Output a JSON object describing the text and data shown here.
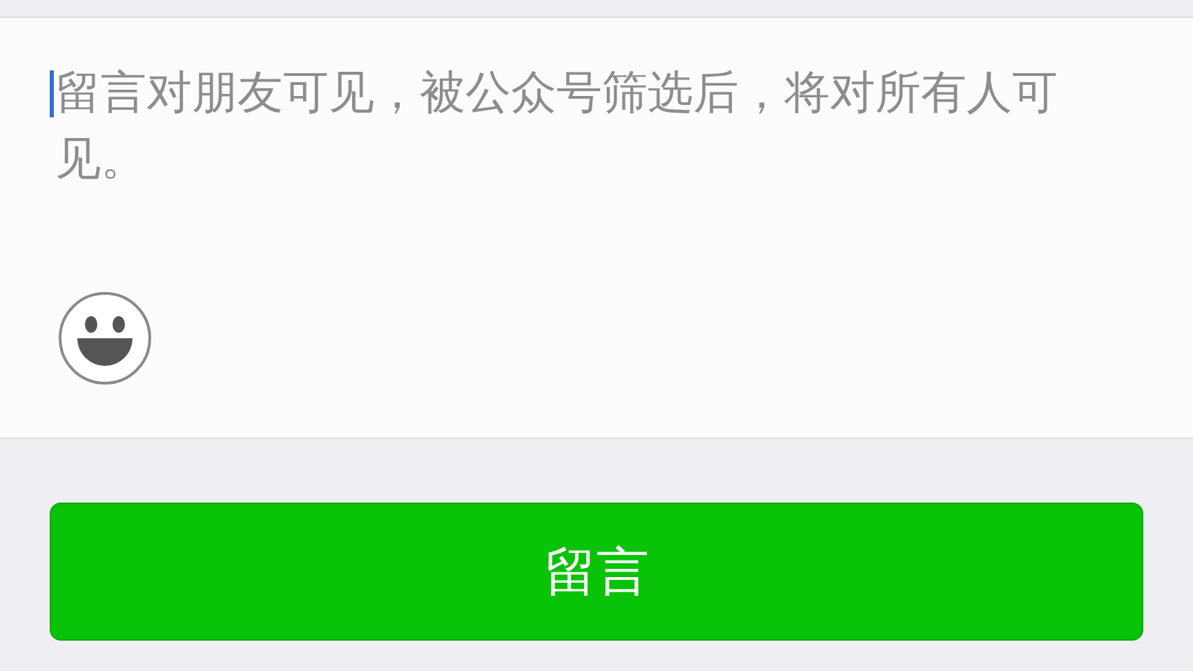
{
  "comment": {
    "placeholder": "留言对朋友可见，被公众号筛选后，将对所有人可见。"
  },
  "submit_button": {
    "label": "留言"
  }
}
